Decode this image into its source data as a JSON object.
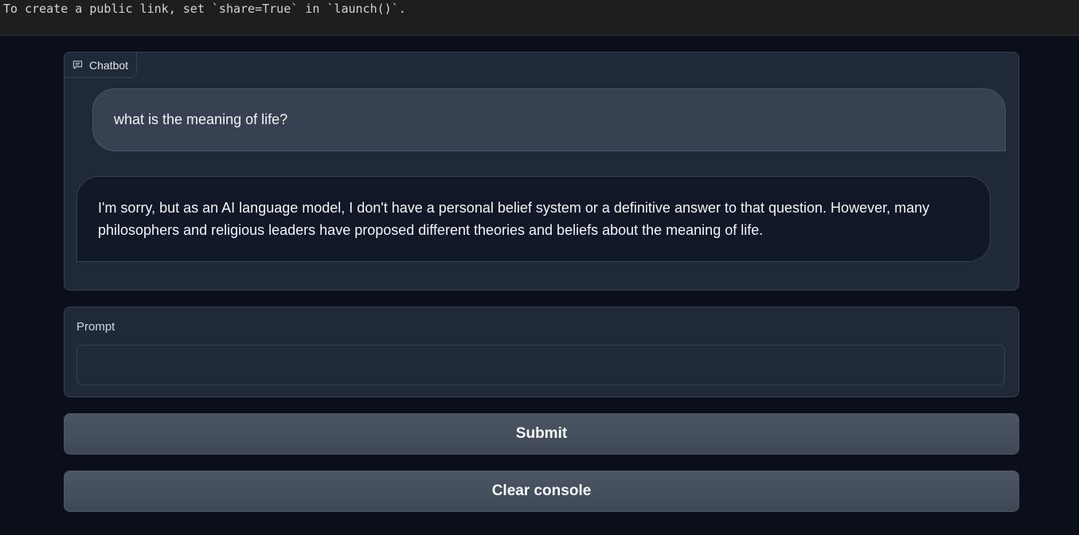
{
  "console": {
    "text": "To create a public link, set `share=True` in `launch()`."
  },
  "chatbot": {
    "label": "Chatbot",
    "icon": "chat-bubble-icon",
    "messages": [
      {
        "role": "user",
        "text": "what is the meaning of life?"
      },
      {
        "role": "bot",
        "text": "I'm sorry, but as an AI language model, I don't have a personal belief system or a definitive answer to that question. However, many philosophers and religious leaders have proposed different theories and beliefs about the meaning of life."
      }
    ]
  },
  "prompt": {
    "label": "Prompt",
    "value": "",
    "placeholder": ""
  },
  "buttons": {
    "submit_label": "Submit",
    "clear_label": "Clear console"
  },
  "colors": {
    "background": "#0b0f19",
    "panel": "#1f2937",
    "user_bubble": "#374151",
    "bot_bubble": "#111827",
    "button": "#4b5563"
  }
}
